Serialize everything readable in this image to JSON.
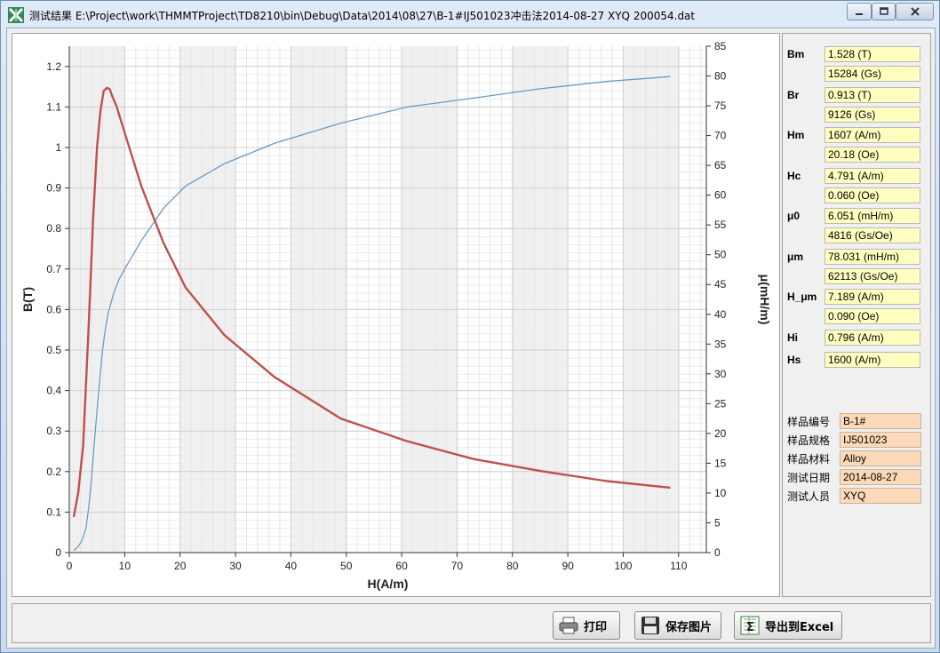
{
  "window": {
    "title": "测试结果 E:\\Project\\work\\THMMTProject\\TD8210\\bin\\Debug\\Data\\2014\\08\\27\\B-1#IJ501023冲击法2014-08-27 XYQ 200054.dat",
    "icons": {
      "app": "app-icon",
      "minimize": "minimize-icon",
      "maximize": "maximize-icon",
      "close": "close-icon"
    }
  },
  "chart_data": {
    "type": "line",
    "xlabel": "H(A/m)",
    "ylabel": "B(T)",
    "y2label": "μ(mH/m)",
    "xlim": [
      0,
      115
    ],
    "ylim": [
      0,
      1.25
    ],
    "y2lim": [
      0,
      85
    ],
    "xticks": [
      "0",
      "10",
      "20",
      "30",
      "40",
      "50",
      "60",
      "70",
      "80",
      "90",
      "100",
      "110"
    ],
    "yticks": [
      "0",
      "0.1",
      "0.2",
      "0.3",
      "0.4",
      "0.5",
      "0.6",
      "0.7",
      "0.8",
      "0.9",
      "1",
      "1.1",
      "1.2"
    ],
    "y2ticks": [
      "0",
      "5",
      "10",
      "15",
      "20",
      "25",
      "30",
      "35",
      "40",
      "45",
      "50",
      "55",
      "60",
      "65",
      "70",
      "75",
      "80",
      "85"
    ],
    "grid": true,
    "series": [
      {
        "axis": "left",
        "color": "#6a9ac8",
        "x": [
          0.8,
          1.6,
          2.3,
          3.0,
          3.5,
          4.0,
          4.5,
          5.0,
          5.5,
          6.0,
          6.5,
          7.0,
          8.0,
          9.0,
          10.0,
          13.0,
          17.0,
          21.0,
          28.0,
          37.0,
          49.0,
          61.0,
          73.0,
          85.0,
          97.0,
          108.5
        ],
        "y": [
          0.005,
          0.015,
          0.03,
          0.06,
          0.11,
          0.18,
          0.27,
          0.35,
          0.43,
          0.5,
          0.55,
          0.59,
          0.64,
          0.675,
          0.7,
          0.77,
          0.85,
          0.905,
          0.96,
          1.01,
          1.06,
          1.1,
          1.122,
          1.145,
          1.163,
          1.175
        ]
      },
      {
        "axis": "right",
        "color": "#c0504d",
        "x": [
          0.8,
          1.6,
          2.5,
          3.5,
          4.3,
          5.0,
          5.6,
          6.2,
          6.8,
          7.3,
          7.8,
          8.5,
          10.0,
          13.0,
          17.0,
          21.0,
          28.0,
          37.0,
          49.0,
          61.0,
          73.0,
          85.0,
          97.0,
          108.5
        ],
        "y": [
          6.0,
          10.0,
          18.0,
          38.0,
          56.0,
          68.0,
          74.0,
          77.5,
          78.0,
          77.8,
          76.5,
          75.0,
          70.5,
          61.5,
          52.0,
          44.5,
          36.5,
          29.5,
          22.5,
          18.7,
          15.7,
          13.7,
          12.0,
          10.9
        ]
      }
    ]
  },
  "params": [
    {
      "label": "Bm",
      "values": [
        "1.528 (T)",
        "15284 (Gs)"
      ]
    },
    {
      "label": "Br",
      "values": [
        "0.913 (T)",
        "9126 (Gs)"
      ]
    },
    {
      "label": "Hm",
      "values": [
        "1607 (A/m)",
        "20.18 (Oe)"
      ]
    },
    {
      "label": "Hc",
      "values": [
        "4.791 (A/m)",
        "0.060 (Oe)"
      ]
    },
    {
      "label": "μ0",
      "values": [
        "6.051 (mH/m)",
        "4816 (Gs/Oe)"
      ]
    },
    {
      "label": "μm",
      "values": [
        "78.031 (mH/m)",
        "62113 (Gs/Oe)"
      ]
    },
    {
      "label": "H_μm",
      "values": [
        "7.189 (A/m)",
        "0.090 (Oe)"
      ]
    },
    {
      "label": "Hi",
      "values": [
        "0.796 (A/m)"
      ]
    },
    {
      "label": "Hs",
      "values": [
        "1600 (A/m)"
      ]
    }
  ],
  "sample_info": [
    {
      "label": "样品编号",
      "value": "B-1#"
    },
    {
      "label": "样品规格",
      "value": "IJ501023"
    },
    {
      "label": "样品材料",
      "value": "Alloy"
    },
    {
      "label": "测试日期",
      "value": "2014-08-27"
    },
    {
      "label": "测试人员",
      "value": "XYQ"
    }
  ],
  "buttons": {
    "print": "打印",
    "save_image": "保存图片",
    "export_excel": "导出到Excel"
  }
}
